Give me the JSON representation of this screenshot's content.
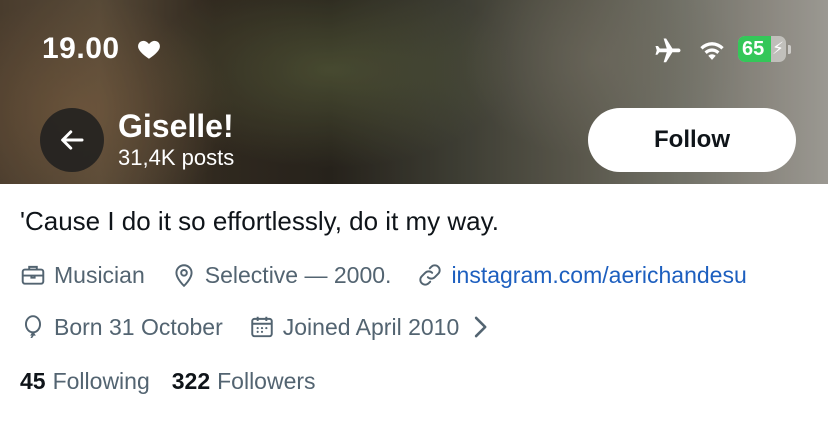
{
  "status_bar": {
    "time": "19.00",
    "battery_level": "65",
    "icons": [
      "heart-icon",
      "airplane-icon",
      "wifi-icon",
      "battery-icon"
    ]
  },
  "header": {
    "name": "Giselle!",
    "posts_count": "31,4K posts",
    "follow_label": "Follow"
  },
  "profile": {
    "bio": "'Cause I do it so effortlessly, do it my way.",
    "category": "Musician",
    "location": "Selective — 2000.",
    "website": "instagram.com/aerichandesu",
    "born": "Born 31 October",
    "joined": "Joined April 2010"
  },
  "stats": {
    "following_count": "45",
    "following_label": "Following",
    "followers_count": "322",
    "followers_label": "Followers"
  },
  "colors": {
    "link": "#1d5fbf",
    "secondary_text": "#536471",
    "battery_green": "#34c759"
  }
}
